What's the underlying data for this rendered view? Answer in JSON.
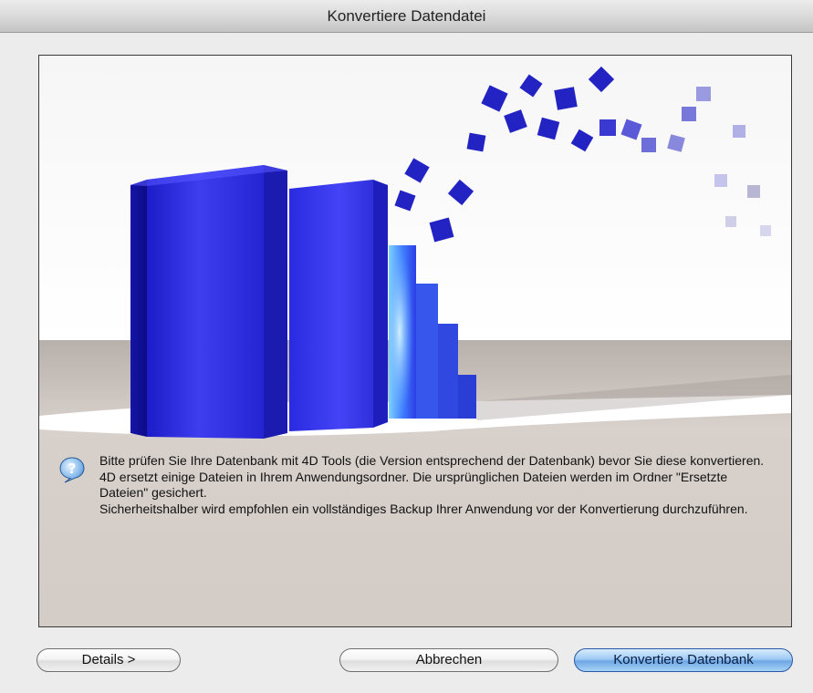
{
  "window": {
    "title": "Konvertiere Datendatei"
  },
  "message": {
    "icon": "help-question-icon",
    "lines": [
      "Bitte prüfen Sie Ihre Datenbank mit 4D Tools (die Version entsprechend der Datenbank) bevor Sie diese konvertieren.",
      "4D ersetzt einige Dateien in Ihrem Anwendungsordner. Die ursprünglichen Dateien werden im Ordner \"Ersetzte Dateien\" gesichert.",
      "Sicherheitshalber wird empfohlen ein vollständiges Backup Ihrer Anwendung vor der Konvertierung durchzuführen."
    ]
  },
  "buttons": {
    "details": "Details >",
    "cancel": "Abbrechen",
    "convert": "Konvertiere Datenbank"
  },
  "colors": {
    "accent": "#3a5fd8",
    "default_button": "#8cc0f0"
  }
}
